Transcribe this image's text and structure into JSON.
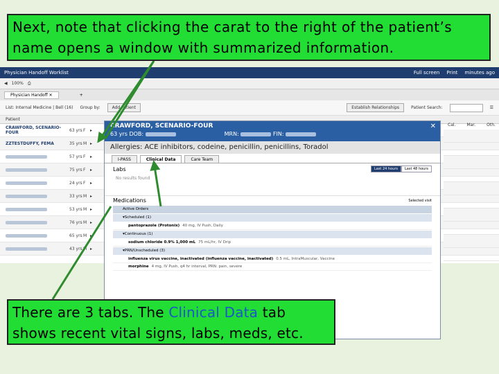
{
  "callouts": {
    "top": "Next, note that clicking the carat to the right of the patient’s name opens a window with summarized information.",
    "bottom_prefix": "There are 3 tabs.  The ",
    "bottom_highlight": "Clinical Data",
    "bottom_suffix": " tab shows recent vital signs, labs, meds, etc."
  },
  "app": {
    "title": "Physician Handoff Worklist",
    "title_right": [
      "Full screen",
      "Print",
      "minutes ago"
    ],
    "toolbar": [
      "100%"
    ],
    "tab": "Physician Handoff",
    "filter": {
      "list": "List: Internal Medicine | Bell (16)",
      "group": "Group by:",
      "add": "Add Patient",
      "establish": "Establish Relationships",
      "search": "Patient Search:"
    },
    "header": "Patient",
    "rows": [
      {
        "name": "CRAWFORD, SCENARIO-FOUR",
        "age": "63 yrs",
        "sex": "F"
      },
      {
        "name": "ZZTESTDUFFY, FEMA",
        "age": "35 yrs",
        "sex": "M"
      },
      {
        "name": "",
        "age": "57 yrs",
        "sex": "F"
      },
      {
        "name": "",
        "age": "75 yrs",
        "sex": "F"
      },
      {
        "name": "",
        "age": "24 yrs",
        "sex": "F"
      },
      {
        "name": "",
        "age": "33 yrs",
        "sex": "M"
      },
      {
        "name": "",
        "age": "53 yrs",
        "sex": "M"
      },
      {
        "name": "",
        "age": "76 yrs",
        "sex": "M"
      },
      {
        "name": "",
        "age": "65 yrs",
        "sex": "M"
      },
      {
        "name": "",
        "age": "43 yrs",
        "sex": "M"
      }
    ],
    "right_cols": [
      "Cal.",
      "Mar.",
      "Oth."
    ]
  },
  "popup": {
    "name": "CRAWFORD, SCENARIO-FOUR",
    "age": "63 yrs",
    "dob_label": "DOB:",
    "mrn_label": "MRN:",
    "fin_label": "FIN:",
    "allergies": "Allergies:  ACE inhibitors, codeine, penicillin, penicillins, Toradol",
    "tabs": [
      "I-PASS",
      "Clinical Data",
      "Care Team"
    ],
    "labs_title": "Labs",
    "labs_buttons": [
      "Last 24 hours",
      "Last 48 hours"
    ],
    "no_results": "No results found",
    "meds_title": "Medications",
    "meds_selected": "Selected visit",
    "active_orders": "Active Orders",
    "groups": [
      {
        "label": "Scheduled (1)",
        "items": [
          {
            "drug": "pantoprazole (Protonix)",
            "detail": "40 mg, IV Push, Daily"
          }
        ]
      },
      {
        "label": "Continuous (1)",
        "items": [
          {
            "drug": "sodium chloride 0.9% 1,000 mL",
            "detail": "75 mL/hr, IV Drip"
          }
        ]
      },
      {
        "label": "PRN/Unscheduled (3)",
        "items": [
          {
            "drug": "influenza virus vaccine, inactivated (influenza vaccine, inactivated)",
            "detail": "0.5 mL, IntraMuscular, Vaccine"
          },
          {
            "drug": "morphine",
            "detail": "4 mg, IV Push, q4 hr interval, PRN: pain, severe"
          }
        ]
      }
    ]
  }
}
